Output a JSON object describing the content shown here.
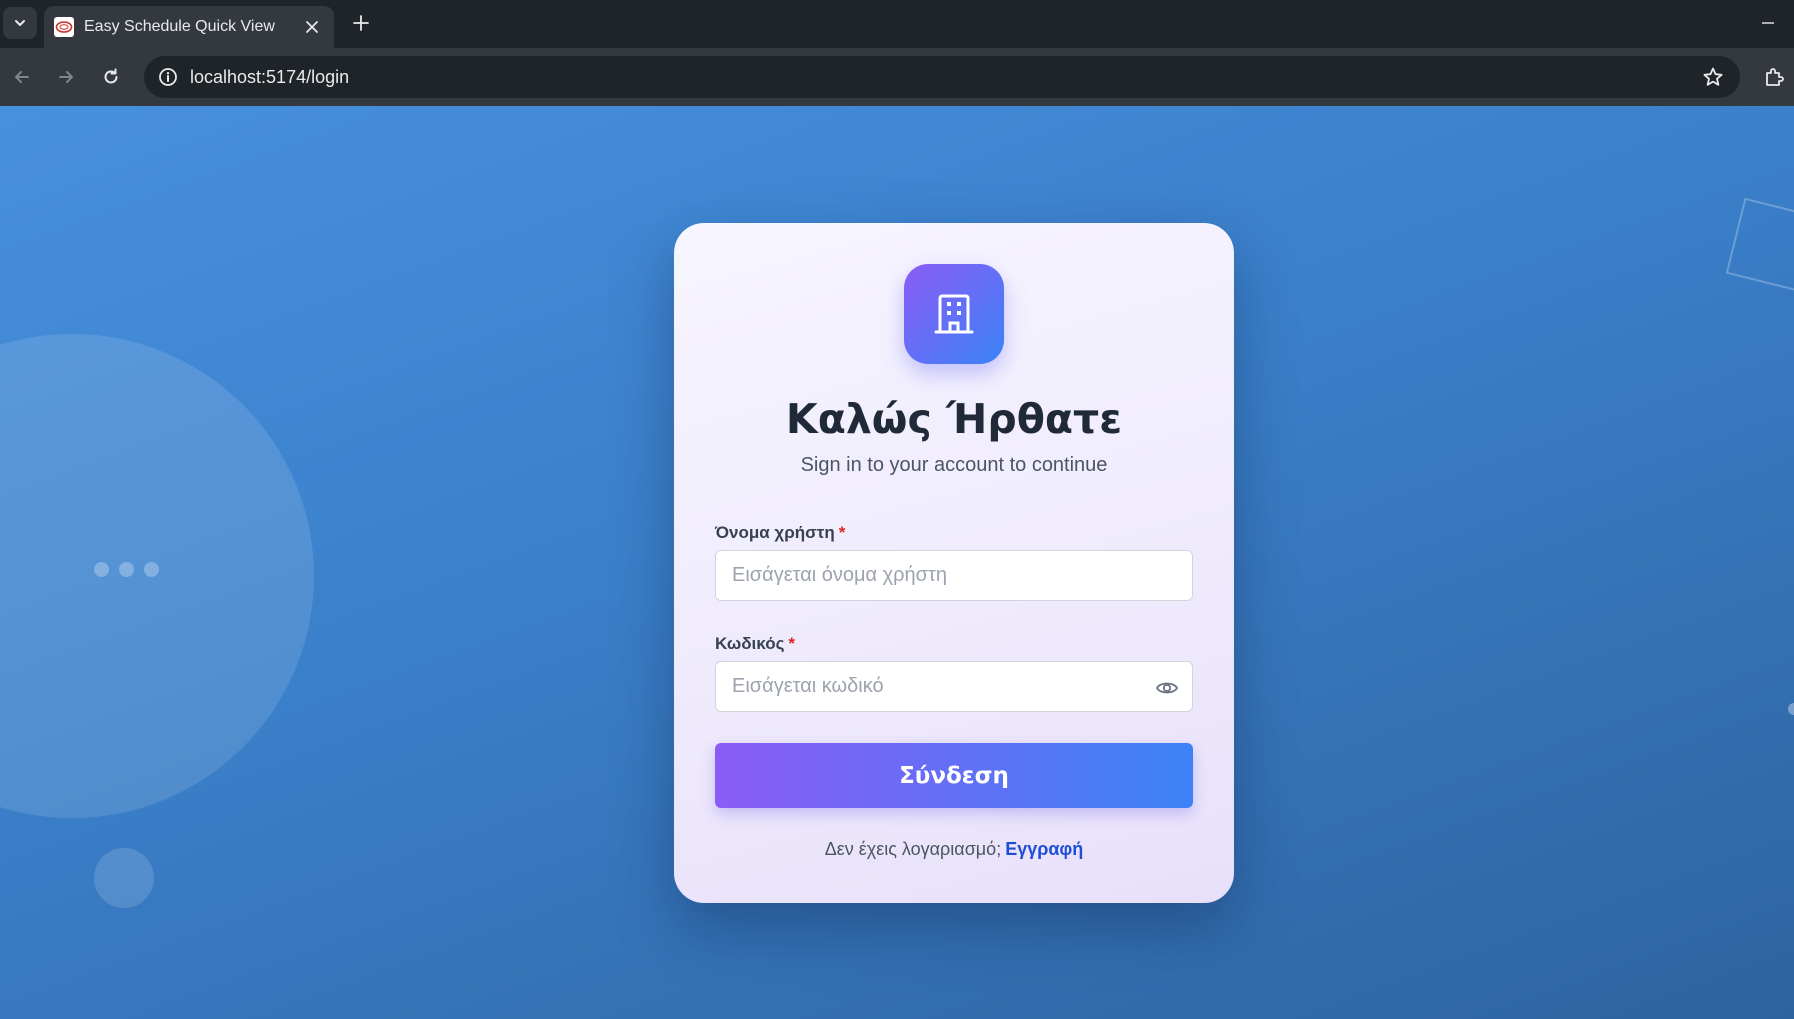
{
  "browser": {
    "tab_title": "Easy Schedule Quick View",
    "url": "localhost:5174/login"
  },
  "login": {
    "title": "Καλώς Ήρθατε",
    "subtitle": "Sign in to your account to continue",
    "username_label": "Όνομα χρήστη",
    "username_placeholder": "Εισάγεται όνομα χρήστη",
    "password_label": "Κωδικός",
    "password_placeholder": "Εισάγεται κωδικό",
    "required_marker": "*",
    "submit_label": "Σύνδεση",
    "signup_prompt": "Δεν έχεις λογαριασμό;",
    "signup_link": "Εγγραφή"
  },
  "colors": {
    "background_top": "#4790de",
    "background_bottom": "#2f63a0",
    "accent_purple": "#8b5cf6",
    "accent_blue": "#3b82f6",
    "link": "#1d4ed8",
    "required": "#dc2626"
  },
  "icons": {
    "logo": "building-icon",
    "password_toggle": "eye-icon"
  }
}
